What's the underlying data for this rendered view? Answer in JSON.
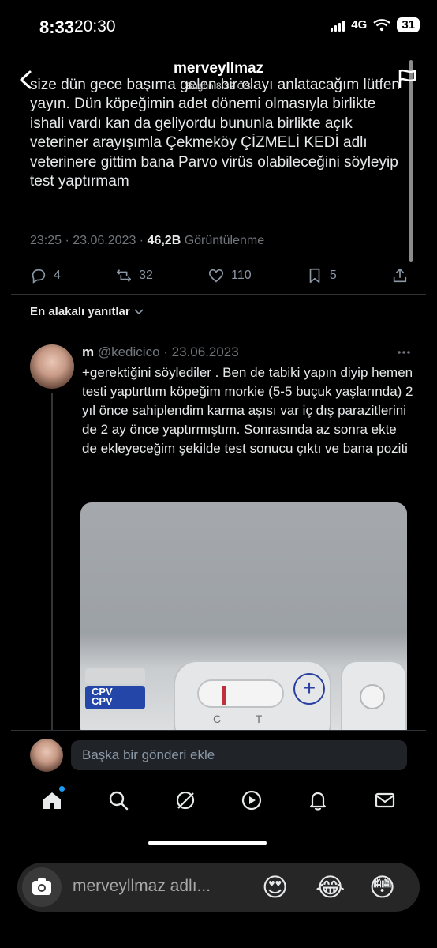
{
  "outer_status": {
    "time": "8:33"
  },
  "inner_status": {
    "time": "20:30",
    "network": "4G",
    "battery": "31"
  },
  "story": {
    "username": "merveyllmaz",
    "meta": "Bugün 8:32 ÖS"
  },
  "tweet": {
    "text": "size dün gece başıma gelen bir olayı anlatacağım lütfen yayın. Dün köpeğimin adet dönemi olmasıyla birlikte ishali vardı kan da geliyordu bununla birlikte açık veteriner arayışımla Çekmeköy ÇİZMELİ KEDİ adlı veterinere gittim bana Parvo virüs olabileceğini söyleyip test yaptırmam",
    "time": "23:25 · 23.06.2023 · ",
    "views": "46,2B",
    "views_label": " Görüntülenme",
    "actions": {
      "replies": "4",
      "reposts": "32",
      "likes": "110",
      "bookmarks": "5"
    }
  },
  "sort_label": "En alakalı yanıtlar",
  "reply": {
    "name": "m",
    "handle_date": " @kedicico · 23.06.2023",
    "text": "+gerektiğini söylediler . Ben de tabiki yapın diyip hemen testi yaptırttım köpeğim morkie (5-5 buçuk yaşlarında) 2 yıl önce sahiplendim karma aşısı var iç dış parazitlerini de 2 ay önce yaptırmıştım. Sonrasında az sonra ekte de ekleyeceğim şekilde test sonucu çıktı ve bana poziti",
    "image": {
      "kit_label_1": "CPV",
      "kit_label_2": "CPV",
      "window_letters": "C T",
      "plus": "+"
    }
  },
  "compose": {
    "placeholder": "Başka bir gönderi ekle"
  },
  "tabbar": [
    "home-icon",
    "search-icon",
    "grok-icon",
    "video-icon",
    "notifications-icon",
    "messages-icon"
  ],
  "story_reply": {
    "placeholder": "merveyllmaz adlı...",
    "emojis": [
      "😍",
      "😂",
      "😳"
    ]
  }
}
